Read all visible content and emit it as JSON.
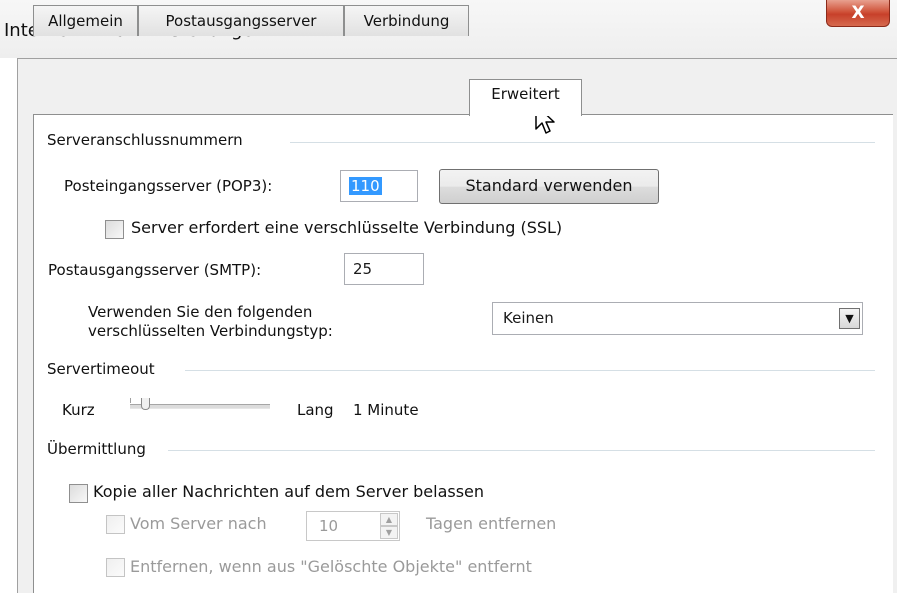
{
  "window": {
    "title": "Internet-E-Mail-Einstellungen",
    "close_label": "X"
  },
  "tabs": [
    {
      "label": "Allgemein",
      "active": false
    },
    {
      "label": "Postausgangsserver",
      "active": false
    },
    {
      "label": "Verbindung",
      "active": false
    },
    {
      "label": "Erweitert",
      "active": true
    }
  ],
  "server_ports": {
    "heading": "Serveranschlussnummern",
    "pop3_label": "Posteingangsserver (POP3):",
    "pop3_value": "110",
    "default_button": "Standard verwenden",
    "ssl_label": "Server erfordert eine verschlüsselte Verbindung (SSL)",
    "ssl_checked": false,
    "smtp_label": "Postausgangsserver (SMTP):",
    "smtp_value": "25",
    "encryption_label_line1": "Verwenden Sie den folgenden",
    "encryption_label_line2": "verschlüsselten Verbindungstyp:",
    "encryption_value": "Keinen"
  },
  "timeout": {
    "heading": "Servertimeout",
    "short_label": "Kurz",
    "long_label": "Lang",
    "value_label": "1 Minute"
  },
  "delivery": {
    "heading": "Übermittlung",
    "keep_copy_label": "Kopie aller Nachrichten auf dem Server belassen",
    "keep_copy_checked": false,
    "remove_after_prefix": "Vom Server nach",
    "remove_after_days": "10",
    "remove_after_suffix": "Tagen entfernen",
    "remove_deleted_label": "Entfernen, wenn aus \"Gelöschte Objekte\" entfernt"
  }
}
